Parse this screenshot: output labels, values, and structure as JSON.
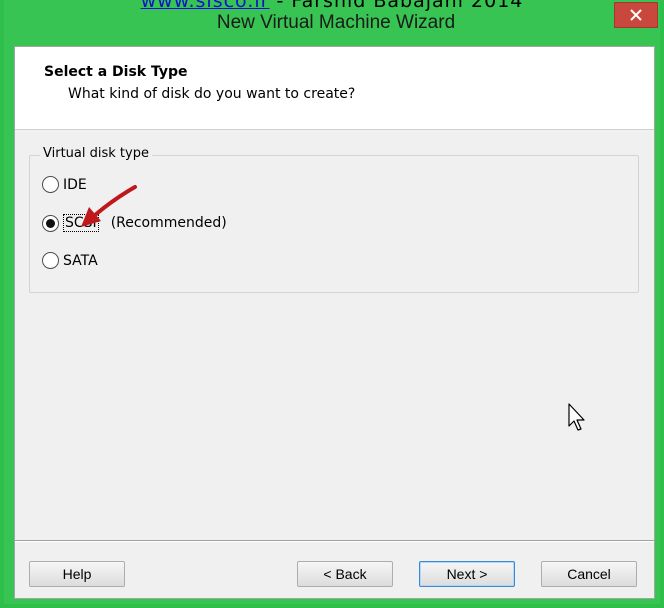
{
  "watermark": {
    "link": "www.sisco.ir",
    "separator": " - ",
    "text": "Farshid Babajani 2014"
  },
  "window": {
    "title": "New Virtual Machine Wizard"
  },
  "header": {
    "title": "Select a Disk Type",
    "subtitle": "What kind of disk do you want to create?"
  },
  "group": {
    "legend": "Virtual disk type",
    "options": [
      {
        "label": "IDE",
        "selected": false
      },
      {
        "label": "SCSI",
        "note": "(Recommended)",
        "selected": true
      },
      {
        "label": "SATA",
        "selected": false
      }
    ]
  },
  "buttons": {
    "help": "Help",
    "back": "< Back",
    "next": "Next >",
    "cancel": "Cancel"
  },
  "colors": {
    "titlebar": "#37c453",
    "close": "#c9483e",
    "arrow": "#c0171d",
    "default_button_border": "#3a89d8"
  },
  "icons": {
    "close": "close-icon",
    "arrow": "red-arrow-annotation",
    "cursor": "mouse-pointer-icon"
  }
}
